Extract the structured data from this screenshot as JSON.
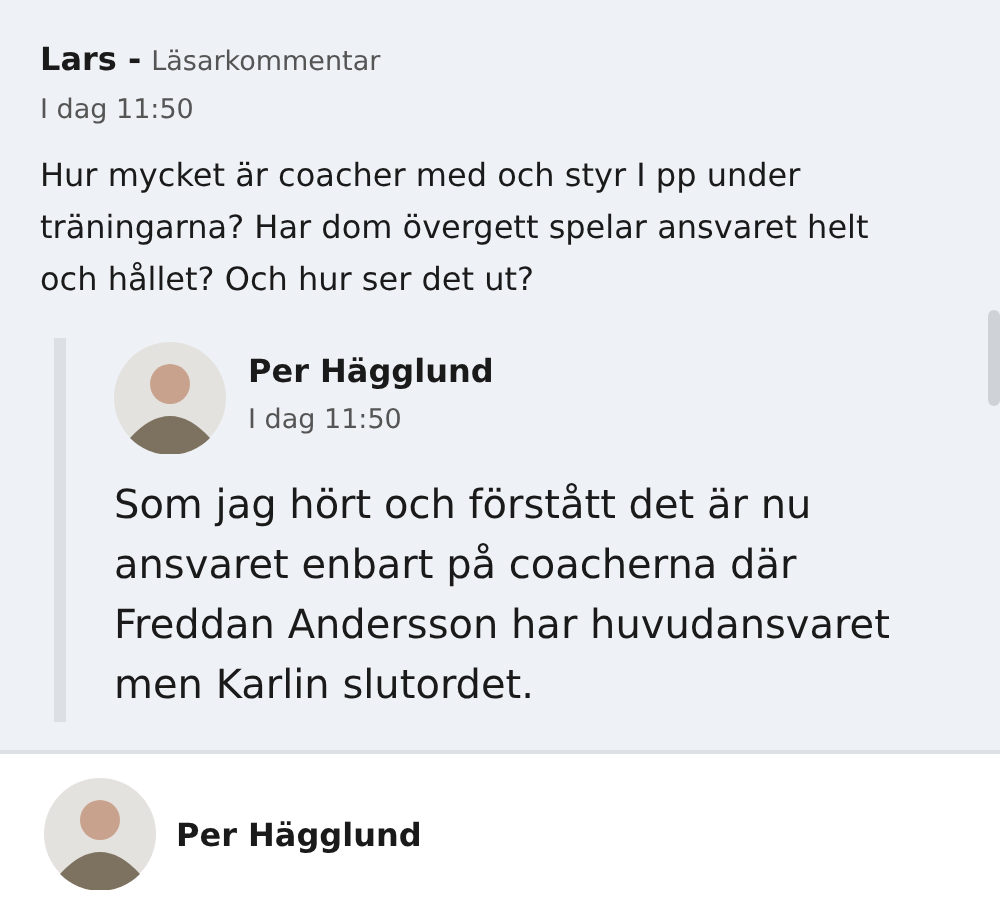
{
  "comment": {
    "author": "Lars -",
    "label": "Läsarkommentar",
    "time": "I dag 11:50",
    "text": "Hur mycket är coacher med och styr I pp under träningarna? Har dom övergett spelar ansvaret helt och hållet? Och hur ser det ut?"
  },
  "reply": {
    "author": "Per Hägglund",
    "time": "I dag 11:50",
    "text": "Som jag hört och förstått det är nu ansvaret enbart på coacherna där Freddan Andersson har huvudansvaret men Karlin slutordet."
  },
  "next_reply": {
    "author": "Per Hägglund"
  }
}
